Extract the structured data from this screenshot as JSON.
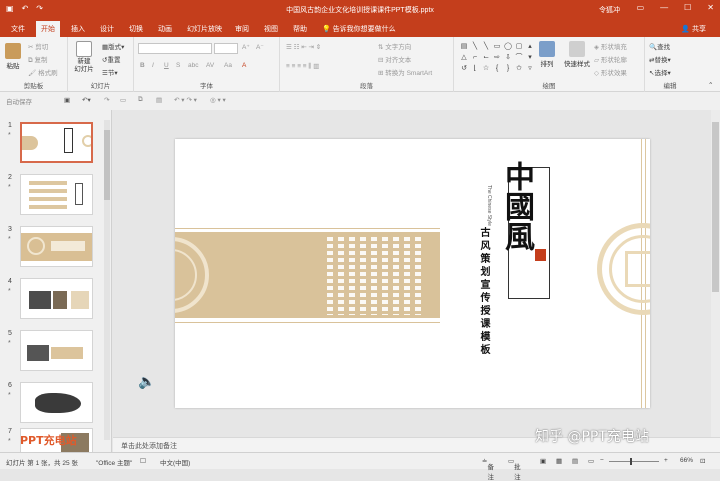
{
  "titlebar": {
    "title": "中国风古韵企业文化培训授课课件PPT模板.pptx",
    "user": "令狐冲"
  },
  "tabs": [
    {
      "label": "文件"
    },
    {
      "label": "开始"
    },
    {
      "label": "插入"
    },
    {
      "label": "设计"
    },
    {
      "label": "切换"
    },
    {
      "label": "动画"
    },
    {
      "label": "幻灯片放映"
    },
    {
      "label": "审阅"
    },
    {
      "label": "视图"
    },
    {
      "label": "帮助"
    }
  ],
  "tellme": "告诉我你想要做什么",
  "share": "共享",
  "ribbon": {
    "clipboard": {
      "paste": "粘贴",
      "cut": "剪切",
      "copy": "复制",
      "format_painter": "格式刷",
      "label": "剪贴板"
    },
    "slides": {
      "new_slide": "新建\n幻灯片",
      "layout": "版式",
      "reset": "重置",
      "section": "节",
      "label": "幻灯片"
    },
    "font": {
      "label": "字体"
    },
    "paragraph": {
      "text_direction": "文字方向",
      "align_text": "对齐文本",
      "smartart": "转换为 SmartArt",
      "label": "段落"
    },
    "drawing": {
      "arrange": "排列",
      "quick_styles": "快速样式",
      "shape_fill": "形状填充",
      "shape_outline": "形状轮廓",
      "shape_effects": "形状效果",
      "label": "绘图"
    },
    "editing": {
      "find": "查找",
      "replace": "替换",
      "select": "选择",
      "label": "编辑"
    }
  },
  "quickbar": {
    "autosave": "自动保存"
  },
  "thumbnails": [
    {
      "num": "1"
    },
    {
      "num": "2"
    },
    {
      "num": "3"
    },
    {
      "num": "4"
    },
    {
      "num": "5"
    },
    {
      "num": "6"
    },
    {
      "num": "7"
    }
  ],
  "slide": {
    "title_chars": "中國風",
    "subtitle_en": "The Chinese Style",
    "subtitle_cn": "古风策划宣传授课模板",
    "seal": "印章"
  },
  "notes": {
    "placeholder": "单击此处添加备注"
  },
  "statusbar": {
    "slide_info": "幻灯片 第 1 张，共 25 张",
    "theme": "\"Office 主题\"",
    "language": "中文(中国)",
    "notes": "备注",
    "comments": "批注",
    "zoom": "66%"
  },
  "watermark": {
    "logo": "PPT充电站",
    "credit": "知乎 @PPT充电站"
  },
  "colors": {
    "accent": "#c43e1c",
    "gold": "#d9c29a",
    "gold_dark": "#c8a877"
  }
}
